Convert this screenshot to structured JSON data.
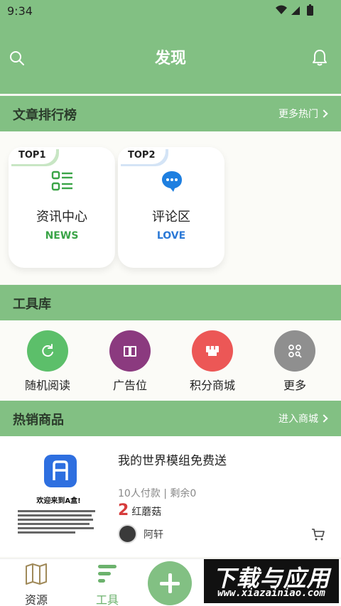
{
  "status_bar": {
    "time": "9:34",
    "icons": "wifi-signal-battery"
  },
  "app_bar": {
    "title": "发现"
  },
  "article_rank": {
    "heading": "文章排行榜",
    "more": "更多热门",
    "cards": [
      {
        "badge": "TOP1",
        "name": "资讯中心",
        "sub": "NEWS",
        "sub_color": "#3aa447",
        "icon": "list-icon"
      },
      {
        "badge": "TOP2",
        "name": "评论区",
        "sub": "LOVE",
        "sub_color": "#2c79d6",
        "icon": "chat-bubble-icon"
      }
    ]
  },
  "toolbox": {
    "heading": "工具库",
    "items": [
      {
        "label": "随机阅读",
        "color": "#5cbf6a",
        "icon": "refresh-icon"
      },
      {
        "label": "广告位",
        "color": "#8b3a7f",
        "icon": "book-icon"
      },
      {
        "label": "积分商城",
        "color": "#ec5756",
        "icon": "store-icon"
      },
      {
        "label": "更多",
        "color": "#8f8f8f",
        "icon": "grid-search-icon"
      }
    ]
  },
  "hot_goods": {
    "heading": "热销商品",
    "more": "进入商城",
    "item": {
      "thumb_title": "欢迎来到A盒!",
      "title": "我的世界模组免费送",
      "meta": "10人付款 | 剩余0",
      "price_num": "2",
      "price_unit": "红蘑菇",
      "author": "阿轩"
    }
  },
  "bottom_nav": {
    "items": [
      {
        "label": "资源",
        "icon": "map-icon"
      },
      {
        "label": "工具",
        "icon": "tools-icon"
      }
    ]
  },
  "watermark": {
    "top": "下载与应用",
    "bottom": "www.xiazainiao.com"
  }
}
